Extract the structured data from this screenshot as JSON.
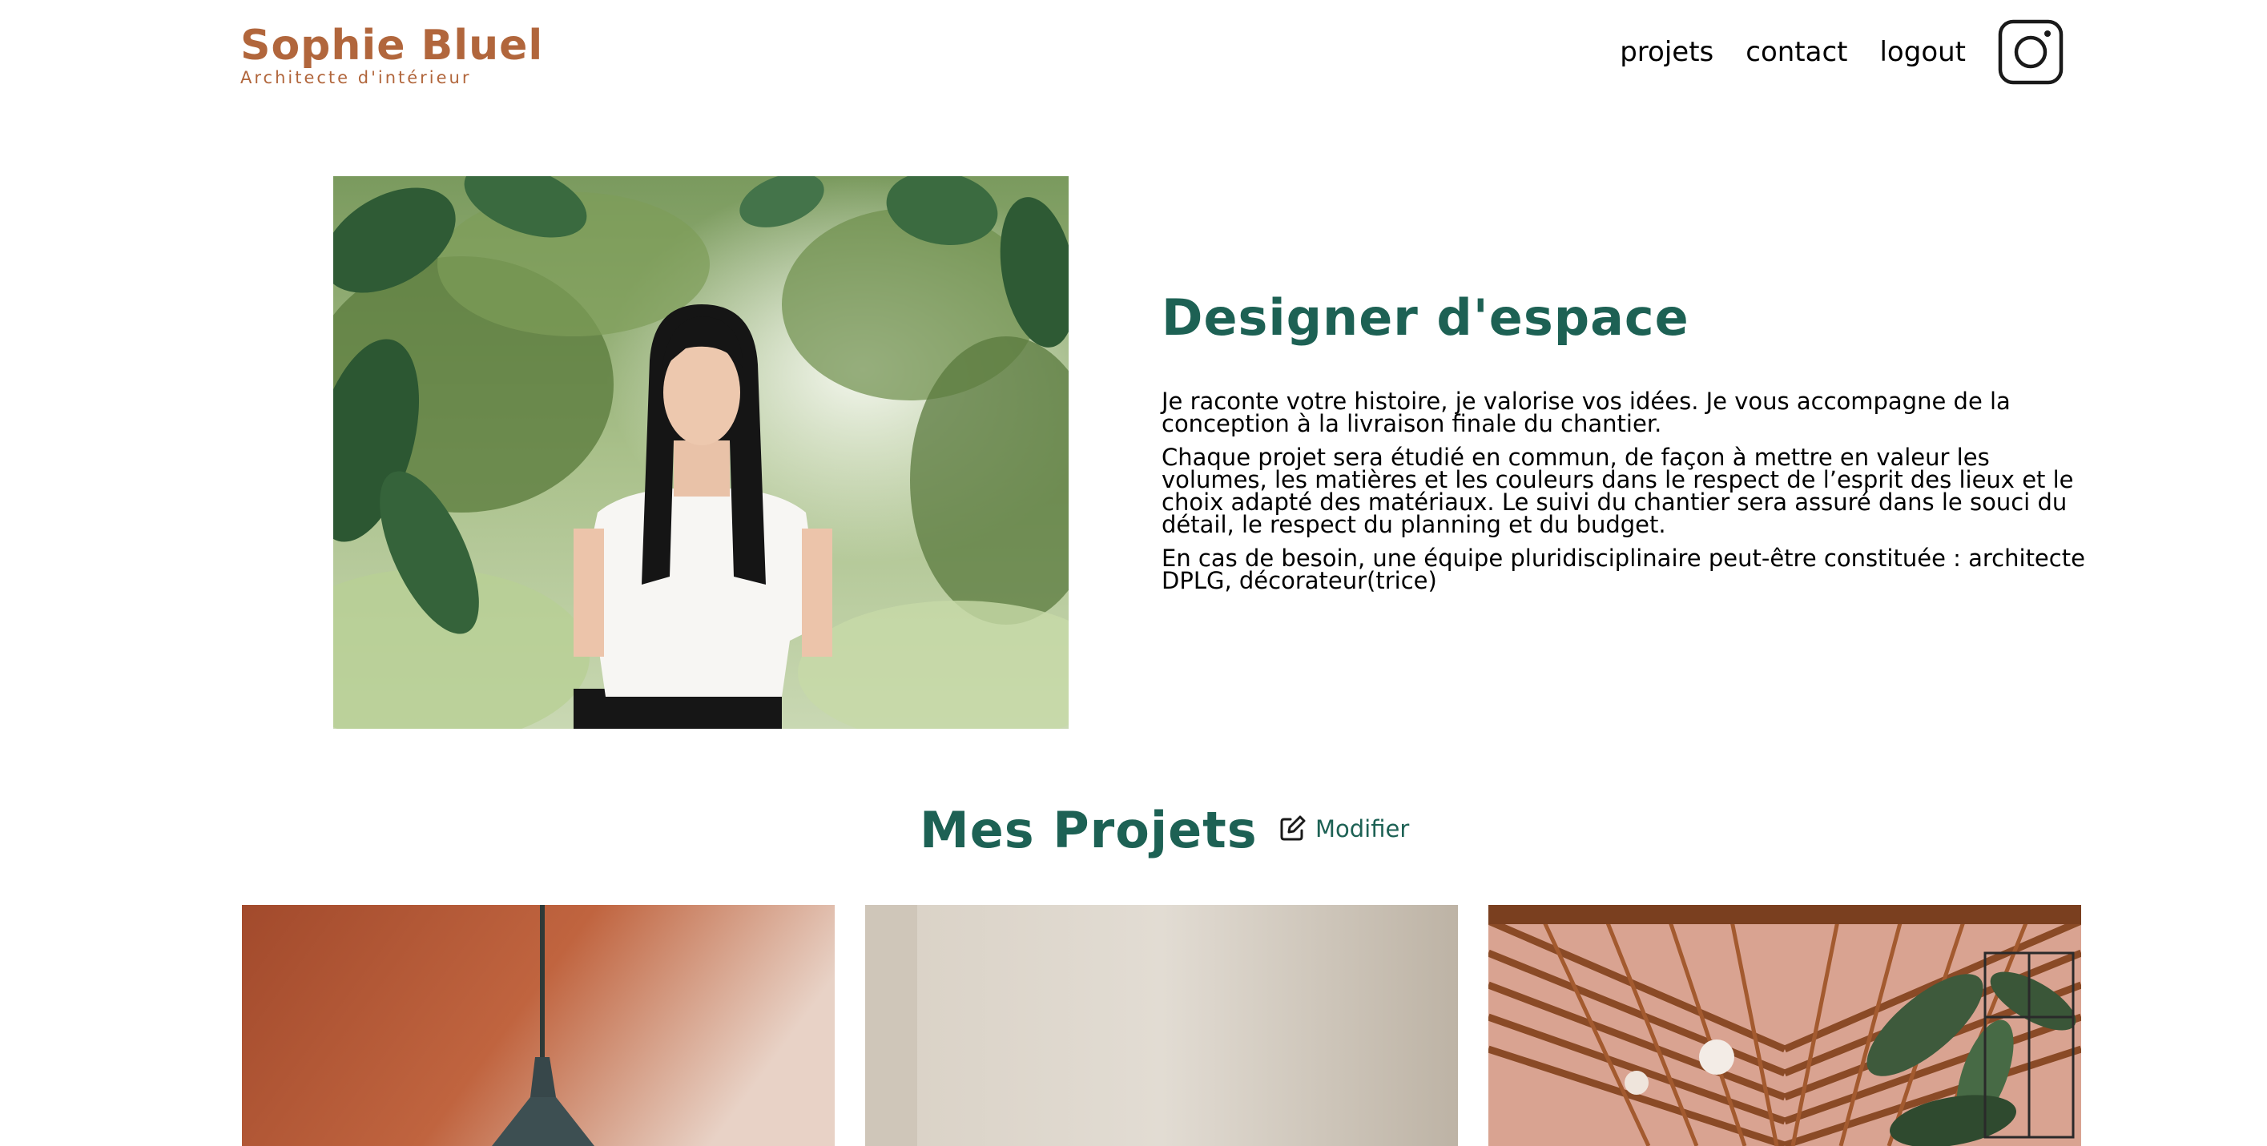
{
  "header": {
    "logo_name": "Sophie Bluel",
    "logo_subtitle": "Architecte d'intérieur",
    "nav": [
      {
        "label": "projets"
      },
      {
        "label": "contact"
      },
      {
        "label": "logout"
      }
    ],
    "social_icon": "instagram-icon"
  },
  "introduction": {
    "photo_alt": "Sophie Bluel",
    "title": "Designer d'espace",
    "paragraphs": [
      "Je raconte votre histoire, je valorise vos idées. Je vous accompagne de la conception à la livraison finale du chantier.",
      "Chaque projet sera étudié en commun, de façon à mettre en valeur les volumes, les matières et les couleurs dans le respect de l’esprit des lieux et le choix adapté des matériaux. Le suivi du chantier sera assuré dans le souci du détail, le respect du planning et du budget.",
      "En cas de besoin, une équipe pluridisciplinaire peut-être constituée : architecte DPLG, décorateur(trice)"
    ]
  },
  "portfolio": {
    "title": "Mes Projets",
    "edit_label": "Modifier",
    "edit_icon": "edit-pen-icon",
    "items": [
      {
        "image": "terracotta-pendant-lamp"
      },
      {
        "image": "beige-minimal-interior"
      },
      {
        "image": "wooden-slat-roof-with-plants"
      }
    ]
  },
  "colors": {
    "brand": "#B1663C",
    "accent": "#1D6154",
    "text": "#000000",
    "background": "#FFFFFF"
  }
}
